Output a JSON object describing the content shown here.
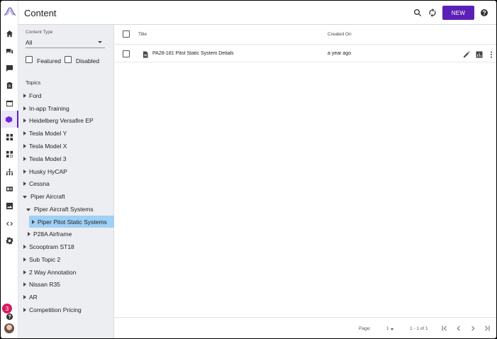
{
  "header": {
    "title": "Content",
    "new_label": "NEW"
  },
  "filters": {
    "content_type_label": "Content Type",
    "content_type_value": "All",
    "featured_label": "Featured",
    "disabled_label": "Disabled",
    "topics_label": "Topics"
  },
  "topics": [
    {
      "label": "Ford"
    },
    {
      "label": "In-app Training"
    },
    {
      "label": "Heidelberg Versafire EP"
    },
    {
      "label": "Tesla Model Y"
    },
    {
      "label": "Tesla Model X"
    },
    {
      "label": "Tesla Model 3"
    },
    {
      "label": "Husky HyCAP"
    },
    {
      "label": "Cessna"
    },
    {
      "label": "Piper Aircraft"
    },
    {
      "label": "Piper Aircraft Systems"
    },
    {
      "label": "Piper Pitot Static Systems"
    },
    {
      "label": "P28A Airframe"
    },
    {
      "label": "Scooptram ST18"
    },
    {
      "label": "Sub Topic 2"
    },
    {
      "label": "2 Way Annotation"
    },
    {
      "label": "Nissan R35"
    },
    {
      "label": "AR"
    },
    {
      "label": "Competition Pricing"
    }
  ],
  "table": {
    "col_title": "Title",
    "col_created": "Created On",
    "rows": [
      {
        "title": "PA28-181 Pitot Static System Detials",
        "created": "a year ago"
      }
    ]
  },
  "footer": {
    "page_label": "Page:",
    "page_value": "1",
    "range": "1 - 1 of 1"
  },
  "rail": {
    "notification_count": "3"
  },
  "colors": {
    "accent": "#5b21b6",
    "selected_topic": "#9fd0f5",
    "badge": "#d81b60"
  }
}
